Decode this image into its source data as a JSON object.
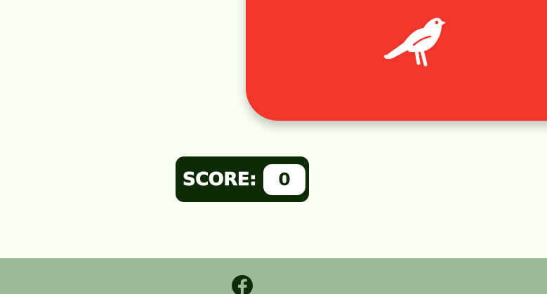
{
  "colors": {
    "background": "#f9fff3",
    "card": "#f2362b",
    "score_box": "#0f2b06",
    "footer": "#9fba9b",
    "icon": "#ffffff",
    "facebook_icon": "#0f2b06"
  },
  "card": {
    "icon": "crow-icon"
  },
  "score": {
    "label": "SCORE:",
    "value": "0"
  },
  "footer": {
    "icon": "facebook-icon"
  }
}
